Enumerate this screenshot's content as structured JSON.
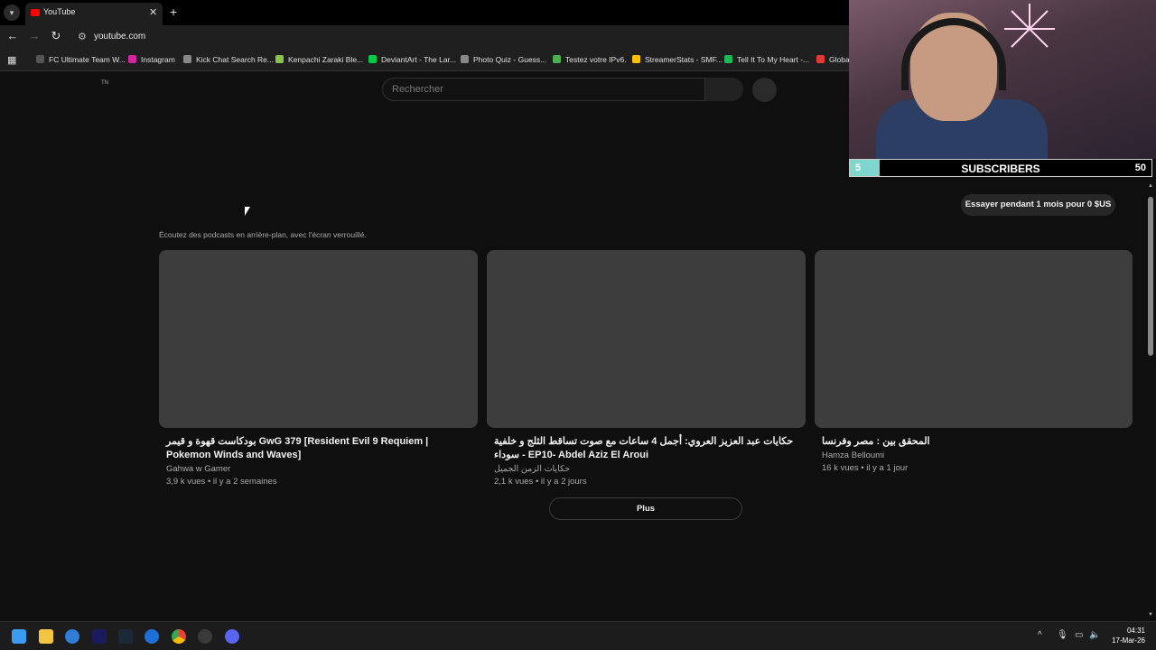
{
  "browser": {
    "tab_title": "YouTube",
    "tab_close": "✕",
    "new_tab": "+",
    "url": "youtube.com",
    "bookmarks": [
      {
        "label": "FC Ultimate Team W...",
        "color": "#555555"
      },
      {
        "label": "Instagram",
        "color": "#d6249f"
      },
      {
        "label": "Kick Chat Search Re...",
        "color": "#888888"
      },
      {
        "label": "Kenpachi Zaraki Ble...",
        "color": "#8bc34a"
      },
      {
        "label": "DeviantArt - The Lar...",
        "color": "#05cc47"
      },
      {
        "label": "Photo Quiz - Guess...",
        "color": "#888888"
      },
      {
        "label": "Testez votre IPv6.",
        "color": "#4caf50"
      },
      {
        "label": "StreamerStats - SMF...",
        "color": "#ffc107"
      },
      {
        "label": "Tell It To My Heart -...",
        "color": "#1db954"
      },
      {
        "label": "Globa",
        "color": "#e53935"
      }
    ]
  },
  "overlay": {
    "subs_current": "5",
    "subs_label": "SUBSCRIBERS",
    "subs_goal": "50",
    "progress_fraction": 0.1,
    "fill_color": "#7fd6cf"
  },
  "youtube": {
    "country_code": "TN",
    "search_placeholder": "Rechercher",
    "trial_button": "Essayer pendant 1 mois pour 0 $US",
    "promo_text": "Écoutez des podcasts en arrière-plan, avec l'écran verrouillé.",
    "more_button": "Plus",
    "videos": [
      {
        "title": "بودكاست قهوة و قيمر GwG 379 [Resident Evil 9 Requiem | Pokemon Winds and Waves]",
        "channel": "Gahwa w Gamer",
        "meta": "3,9 k vues • il y a 2 semaines"
      },
      {
        "title": "حكايات عبد العزيز العروي: أجمل 4 ساعات مع صوت تساقط الثلج و خلفية سوداء - EP10- Abdel Aziz El Aroui",
        "channel": "حكايات الزمن الجميل",
        "meta": "2,1 k vues • il y a 2 jours"
      },
      {
        "title": "المحقق بين : مصر وفرنسا",
        "channel": "Hamza Belloumi",
        "meta": "16 k vues • il y a 1 jour"
      }
    ]
  },
  "taskbar": {
    "time": "04:31",
    "date": "17-Mar-26"
  }
}
